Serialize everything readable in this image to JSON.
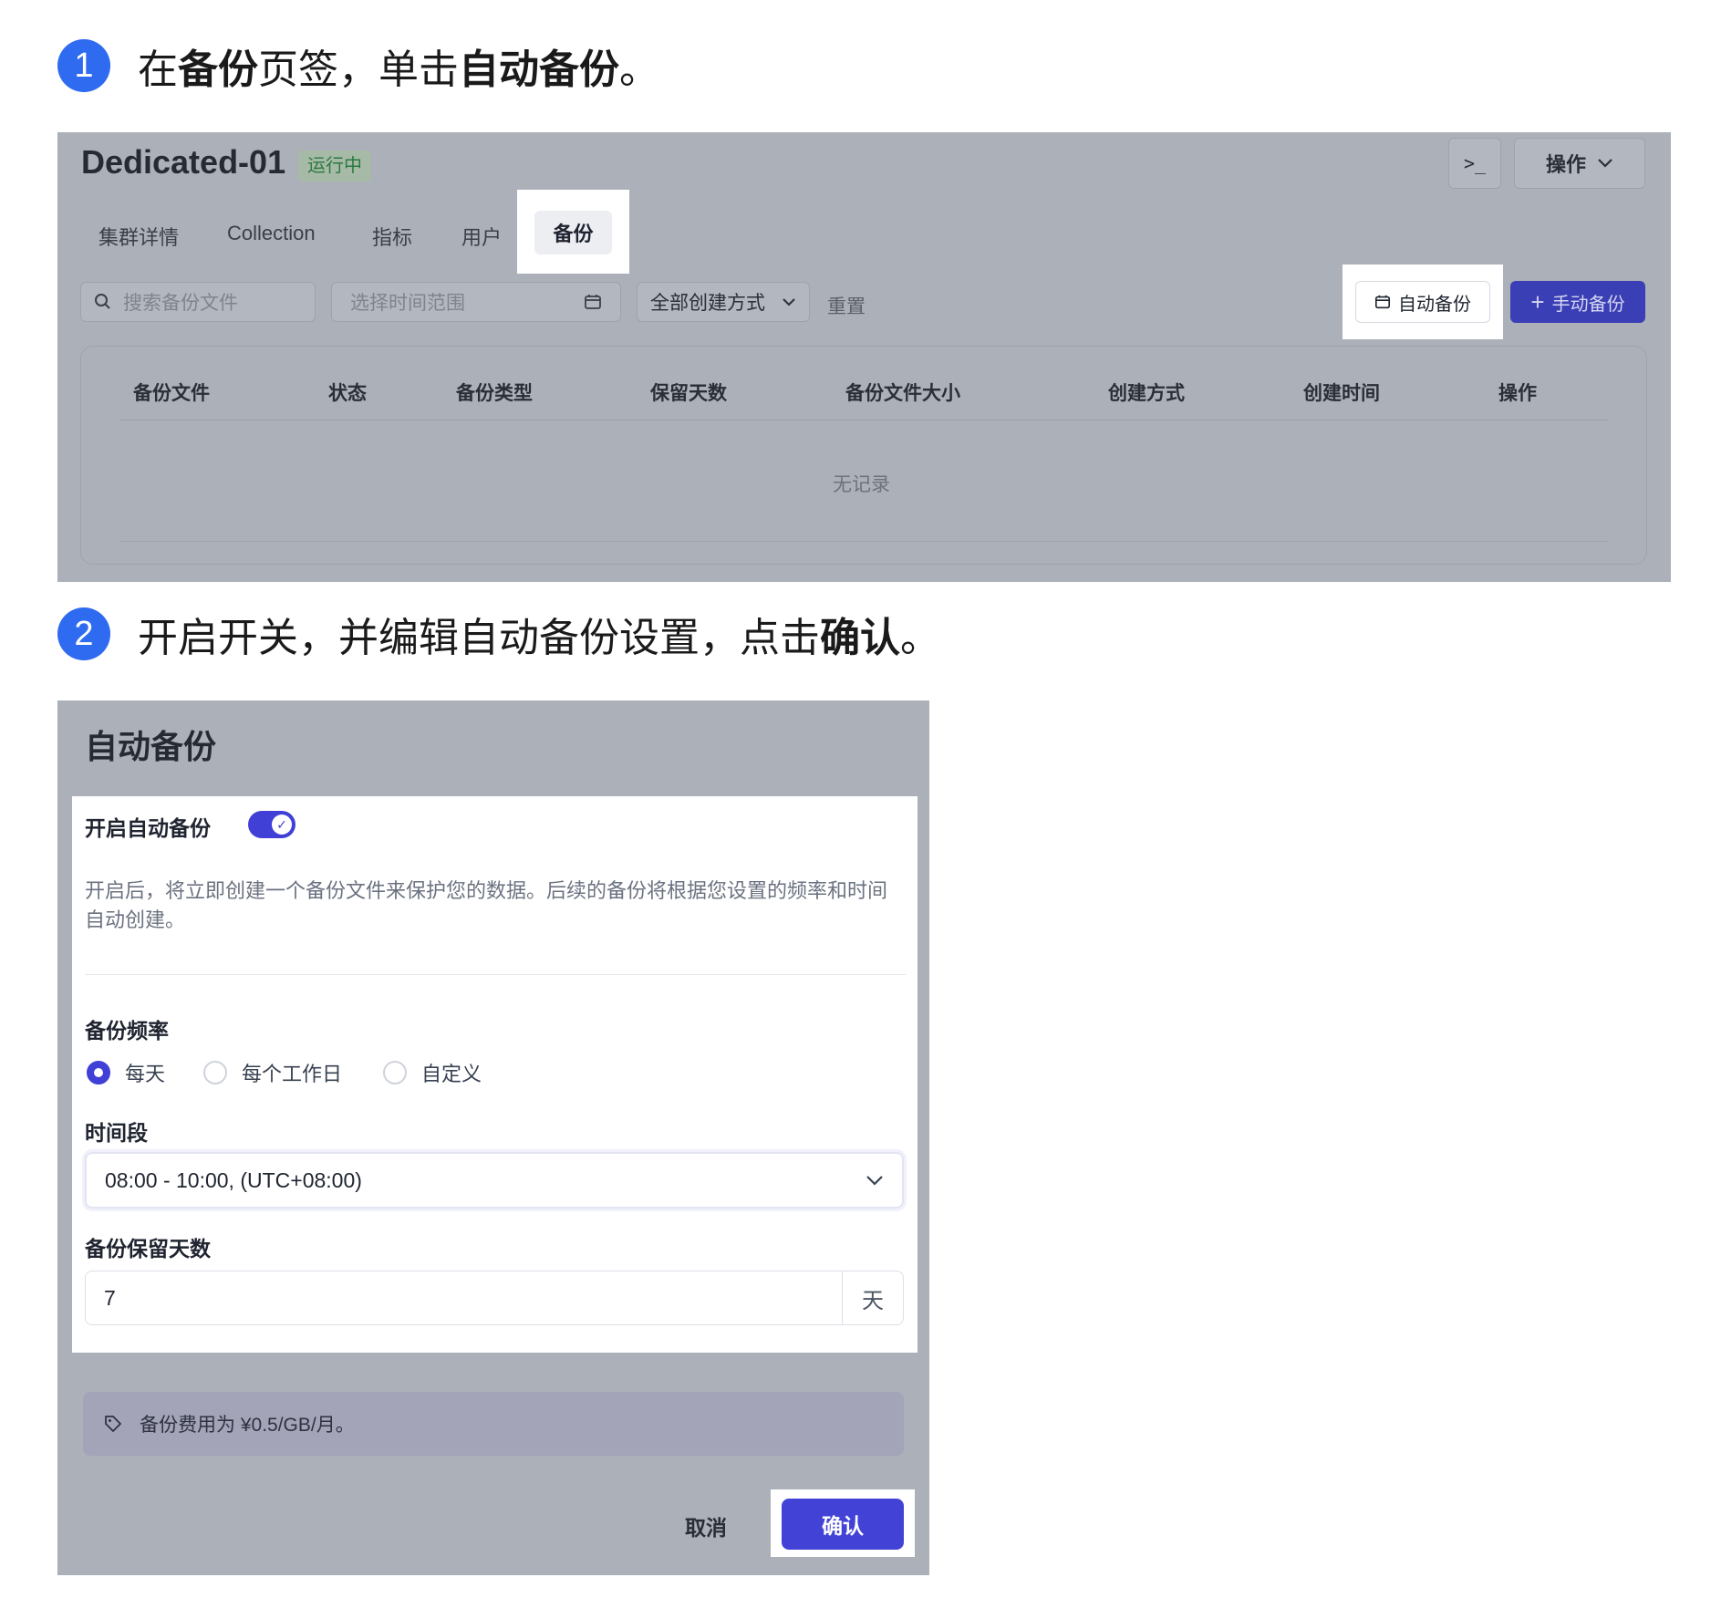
{
  "steps": [
    {
      "num": "1",
      "pre": "在",
      "b1": "备份",
      "mid": "页签，单击",
      "b2": "自动备份",
      "post": "。"
    },
    {
      "num": "2",
      "pre": "开启开关，并编辑自动备份设置，点击",
      "b1": "确认",
      "post": "。"
    }
  ],
  "cluster": {
    "title": "Dedicated-01",
    "status": "运行中",
    "terminal_label": ">_",
    "ops_label": "操作",
    "tabs": [
      "集群详情",
      "Collection",
      "指标",
      "用户",
      "备份"
    ],
    "search_placeholder": "搜索备份文件",
    "time_placeholder": "选择时间范围",
    "creation_filter": "全部创建方式",
    "reset_label": "重置",
    "auto_backup_label": "自动备份",
    "manual_backup_label": "手动备份",
    "columns": [
      "备份文件",
      "状态",
      "备份类型",
      "保留天数",
      "备份文件大小",
      "创建方式",
      "创建时间",
      "操作"
    ],
    "empty_text": "无记录"
  },
  "dialog": {
    "title": "自动备份",
    "enable_label": "开启自动备份",
    "enabled": true,
    "description": "开启后，将立即创建一个备份文件来保护您的数据。后续的备份将根据您设置的频率和时间自动创建。",
    "frequency_label": "备份频率",
    "frequency_options": [
      "每天",
      "每个工作日",
      "自定义"
    ],
    "frequency_selected": "每天",
    "time_label": "时间段",
    "time_value": "08:00 - 10:00, (UTC+08:00)",
    "retention_label": "备份保留天数",
    "retention_value": "7",
    "retention_unit": "天",
    "fee_text": "备份费用为 ¥0.5/GB/月。",
    "cancel_label": "取消",
    "confirm_label": "确认"
  },
  "colors": {
    "accent": "#4140d6",
    "step": "#2f6bf0",
    "overlay": "#acb0b9"
  }
}
